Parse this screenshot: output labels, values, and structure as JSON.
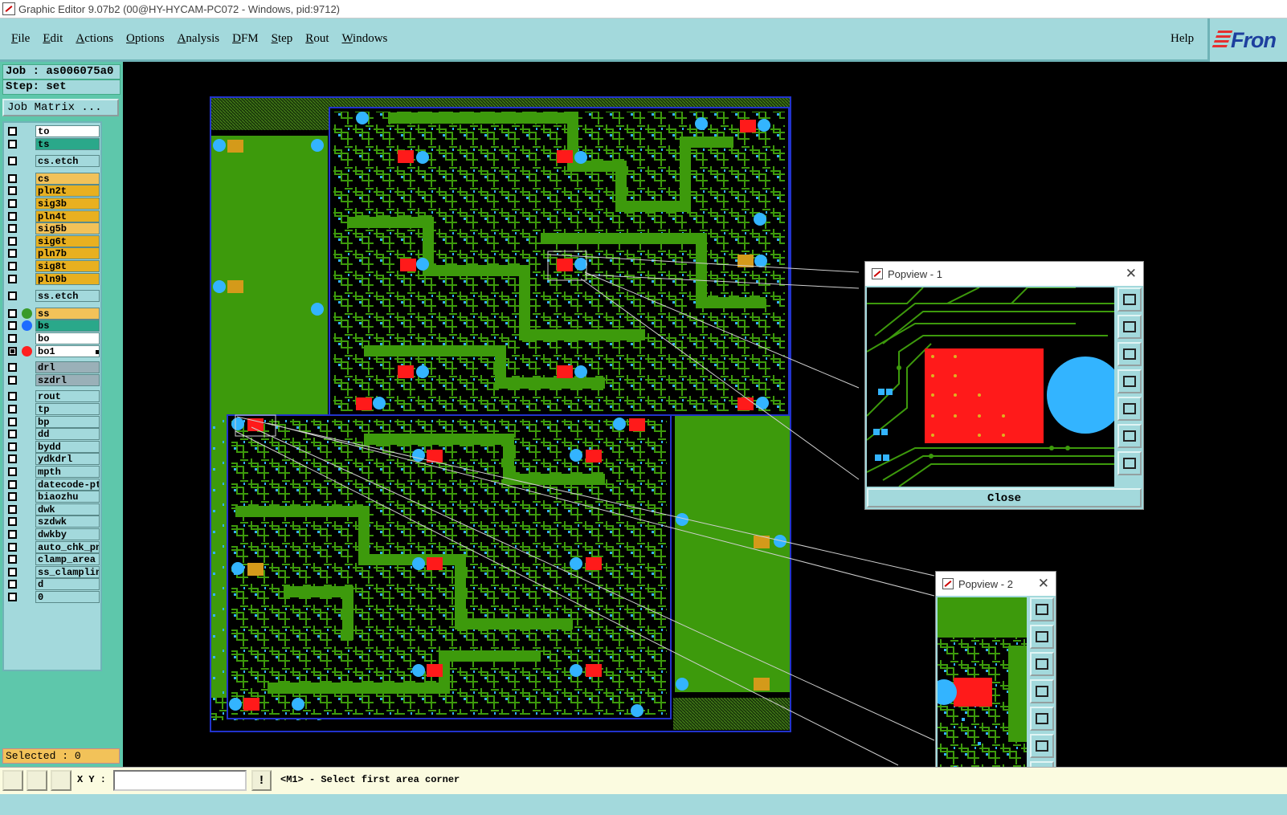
{
  "window": {
    "title": "Graphic Editor 9.07b2 (00@HY-HYCAM-PC072 - Windows, pid:9712)"
  },
  "menu": {
    "items": [
      "File",
      "Edit",
      "Actions",
      "Options",
      "Analysis",
      "DFM",
      "Step",
      "Rout",
      "Windows"
    ],
    "help": "Help",
    "logo": "Fron"
  },
  "job": {
    "job_line": "Job : as006075a0",
    "step_line": "Step: set",
    "matrix_button": "Job Matrix ..."
  },
  "layers": [
    {
      "name": "to",
      "color": "#ffffff",
      "dot": ""
    },
    {
      "name": "ts",
      "color": "#2aa88a",
      "dot": ""
    },
    {
      "name": "cs.etch",
      "color": "#a3d9dc",
      "dot": ""
    },
    {
      "name": "cs",
      "color": "#f2c259",
      "dot": ""
    },
    {
      "name": "pln2t",
      "color": "#e8b020",
      "dot": ""
    },
    {
      "name": "sig3b",
      "color": "#e8b020",
      "dot": ""
    },
    {
      "name": "pln4t",
      "color": "#e8b020",
      "dot": ""
    },
    {
      "name": "sig5b",
      "color": "#f2c259",
      "dot": ""
    },
    {
      "name": "sig6t",
      "color": "#e8b020",
      "dot": ""
    },
    {
      "name": "pln7b",
      "color": "#e8b020",
      "dot": ""
    },
    {
      "name": "sig8t",
      "color": "#e8b020",
      "dot": ""
    },
    {
      "name": "pln9b",
      "color": "#e8b020",
      "dot": ""
    },
    {
      "name": "ss.etch",
      "color": "#a3d9dc",
      "dot": ""
    },
    {
      "name": "ss",
      "color": "#f2c259",
      "dot": "#3a9a2a"
    },
    {
      "name": "bs",
      "color": "#2aa88a",
      "dot": "#1e6bff"
    },
    {
      "name": "bo",
      "color": "#ffffff",
      "dot": ""
    },
    {
      "name": "bo1",
      "color": "#ffffff",
      "dot": "#ff2020"
    },
    {
      "name": "drl",
      "color": "#9ab0b8",
      "dot": ""
    },
    {
      "name": "szdrl",
      "color": "#9ab0b8",
      "dot": ""
    },
    {
      "name": "rout",
      "color": "#a3d9dc",
      "dot": ""
    },
    {
      "name": "tp",
      "color": "#a3d9dc",
      "dot": ""
    },
    {
      "name": "bp",
      "color": "#a3d9dc",
      "dot": ""
    },
    {
      "name": "dd",
      "color": "#a3d9dc",
      "dot": ""
    },
    {
      "name": "bydd",
      "color": "#a3d9dc",
      "dot": ""
    },
    {
      "name": "ydkdrl",
      "color": "#a3d9dc",
      "dot": ""
    },
    {
      "name": "mpth",
      "color": "#a3d9dc",
      "dot": ""
    },
    {
      "name": "datecode-pte",
      "color": "#a3d9dc",
      "dot": ""
    },
    {
      "name": "biaozhu",
      "color": "#a3d9dc",
      "dot": ""
    },
    {
      "name": "dwk",
      "color": "#a3d9dc",
      "dot": ""
    },
    {
      "name": "szdwk",
      "color": "#a3d9dc",
      "dot": ""
    },
    {
      "name": "dwkby",
      "color": "#a3d9dc",
      "dot": ""
    },
    {
      "name": "auto_chk_pnl",
      "color": "#a3d9dc",
      "dot": ""
    },
    {
      "name": "clamp_area",
      "color": "#a3d9dc",
      "dot": ""
    },
    {
      "name": "ss_clampline",
      "color": "#a3d9dc",
      "dot": ""
    },
    {
      "name": "d",
      "color": "#a3d9dc",
      "dot": ""
    },
    {
      "name": "0",
      "color": "#a3d9dc",
      "dot": ""
    }
  ],
  "selected": "Selected : 0",
  "popview1": {
    "title": "Popview - 1",
    "close": "Close"
  },
  "popview2": {
    "title": "Popview - 2"
  },
  "status": {
    "xy_label": "X Y :",
    "xy_value": "",
    "message": "<M1> - Select first area corner"
  },
  "colors": {
    "board_green": "#3d9a0c",
    "pad_red": "#ff1a1a",
    "via_blue": "#33b4ff",
    "panel": "#a3d9dc"
  }
}
